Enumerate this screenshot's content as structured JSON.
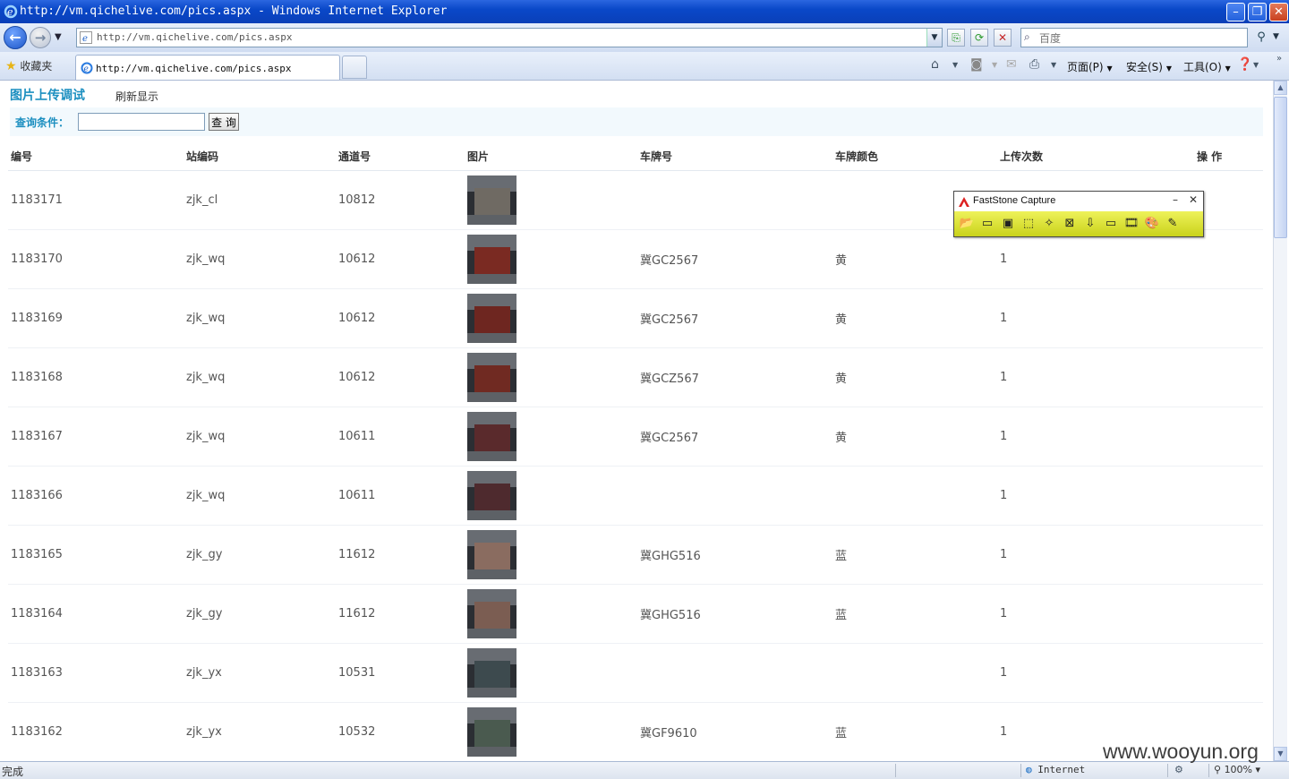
{
  "window": {
    "title": "http://vm.qichelive.com/pics.aspx - Windows Internet Explorer",
    "minimize": "–",
    "restore": "❐",
    "close": "✕"
  },
  "nav": {
    "url": "http://vm.qichelive.com/pics.aspx",
    "search_placeholder": "百度"
  },
  "tabs": {
    "favorites_label": "收藏夹",
    "active_tab": "http://vm.qichelive.com/pics.aspx"
  },
  "commands": {
    "page": "页面(P)",
    "safety": "安全(S)",
    "tools": "工具(O)"
  },
  "page": {
    "title": "图片上传调试",
    "refresh_link": "刷新显示",
    "query_label": "查询条件：",
    "query_value": "",
    "query_button": "查 询"
  },
  "table": {
    "headers": [
      "编号",
      "站编码",
      "通道号",
      "图片",
      "车牌号",
      "车牌颜色",
      "上传次数",
      "操 作"
    ],
    "rows": [
      {
        "id": "1183171",
        "station": "zjk_cl",
        "channel": "10812",
        "plate": "",
        "color": "",
        "count": "",
        "tone": "#6f6a63"
      },
      {
        "id": "1183170",
        "station": "zjk_wq",
        "channel": "10612",
        "plate": "冀GC2567",
        "color": "黄",
        "count": "1",
        "tone": "#7a2a22"
      },
      {
        "id": "1183169",
        "station": "zjk_wq",
        "channel": "10612",
        "plate": "冀GC2567",
        "color": "黄",
        "count": "1",
        "tone": "#6e2620"
      },
      {
        "id": "1183168",
        "station": "zjk_wq",
        "channel": "10612",
        "plate": "冀GCZ567",
        "color": "黄",
        "count": "1",
        "tone": "#702a22"
      },
      {
        "id": "1183167",
        "station": "zjk_wq",
        "channel": "10611",
        "plate": "冀GC2567",
        "color": "黄",
        "count": "1",
        "tone": "#5a2a2c"
      },
      {
        "id": "1183166",
        "station": "zjk_wq",
        "channel": "10611",
        "plate": "",
        "color": "",
        "count": "1",
        "tone": "#4e2a2e"
      },
      {
        "id": "1183165",
        "station": "zjk_gy",
        "channel": "11612",
        "plate": "冀GHG516",
        "color": "蓝",
        "count": "1",
        "tone": "#8a6c60"
      },
      {
        "id": "1183164",
        "station": "zjk_gy",
        "channel": "11612",
        "plate": "冀GHG516",
        "color": "蓝",
        "count": "1",
        "tone": "#7b5d52"
      },
      {
        "id": "1183163",
        "station": "zjk_yx",
        "channel": "10531",
        "plate": "",
        "color": "",
        "count": "1",
        "tone": "#3d4a4e"
      },
      {
        "id": "1183162",
        "station": "zjk_yx",
        "channel": "10532",
        "plate": "冀GF9610",
        "color": "蓝",
        "count": "1",
        "tone": "#4a5a4f"
      }
    ]
  },
  "faststone": {
    "title": "FastStone Capture",
    "minimize": "–",
    "close": "✕",
    "tools": [
      "open-icon",
      "capture-window-icon",
      "capture-object-icon",
      "capture-rect-icon",
      "capture-freehand-icon",
      "capture-fullscreen-icon",
      "capture-scroll-icon",
      "capture-fixed-icon",
      "capture-video-icon",
      "output-icon",
      "settings-icon"
    ]
  },
  "status": {
    "text": "完成",
    "zone": "Internet",
    "zoom": "100%"
  },
  "watermark": "www.wooyun.org"
}
